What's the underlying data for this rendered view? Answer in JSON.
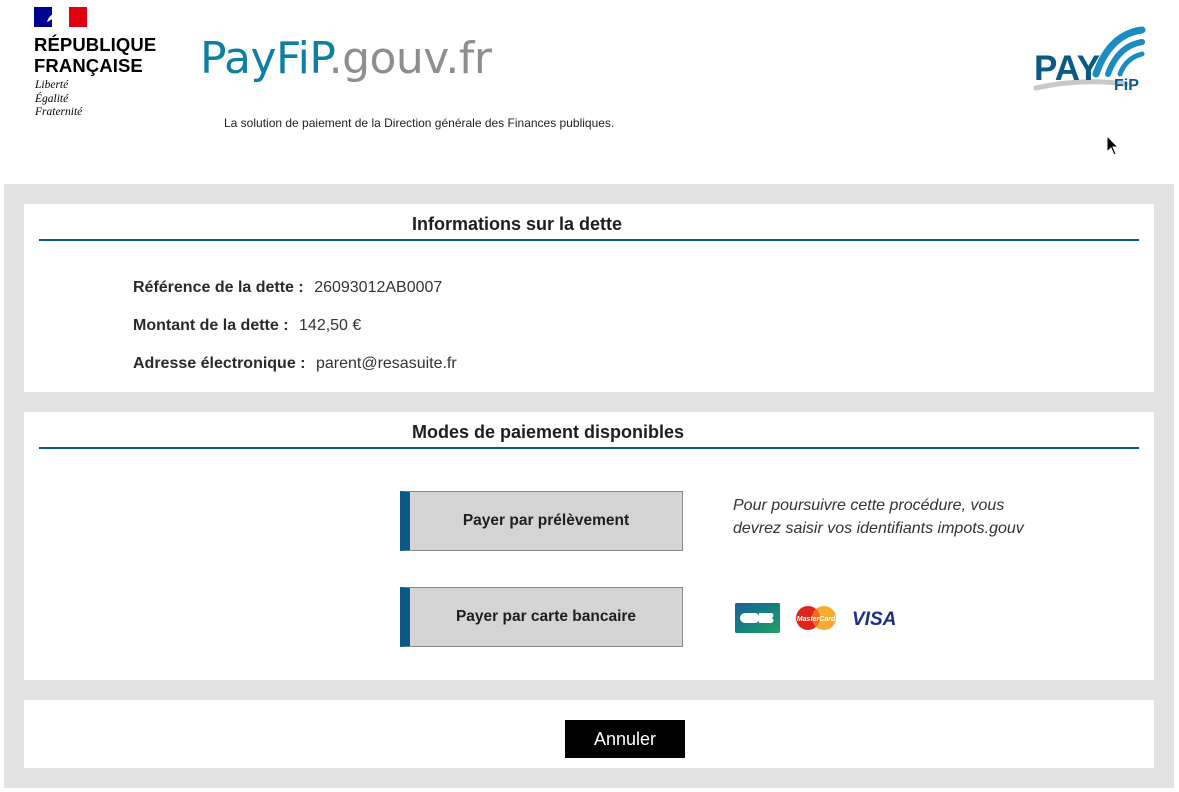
{
  "header": {
    "republic_line1": "RÉPUBLIQUE",
    "republic_line2": "FRANÇAISE",
    "devise": [
      "Liberté",
      "Égalité",
      "Fraternité"
    ],
    "site_title_part1": "PayFiP",
    "site_title_part2": ".gouv.fr",
    "tagline": "La solution de paiement de la Direction générale des Finances publiques.",
    "logo_text_main": "PAY",
    "logo_text_sub": "FiP"
  },
  "debt_info": {
    "title": "Informations sur la dette",
    "reference_label": "Référence de la dette :",
    "reference_value": "26093012AB0007",
    "amount_label": "Montant de la dette :",
    "amount_value": "142,50 €",
    "email_label": "Adresse électronique :",
    "email_value": "parent@resasuite.fr"
  },
  "payment_modes": {
    "title": "Modes de paiement disponibles",
    "direct_debit_button": "Payer par prélèvement",
    "direct_debit_note": "Pour poursuivre cette procédure, vous devrez saisir vos identifiants impots.gouv",
    "card_button": "Payer par carte bancaire",
    "card_logos": [
      "cb-icon",
      "mastercard-icon",
      "visa-icon"
    ],
    "mastercard_text": "MasterCard",
    "visa_text": "VISA"
  },
  "footer": {
    "cancel_button": "Annuler"
  },
  "colors": {
    "accent_blue": "#0b5a86",
    "title_blue": "#0f7fa0",
    "frame_grey": "#e3e3e3",
    "button_grey": "#d4d4d4"
  }
}
